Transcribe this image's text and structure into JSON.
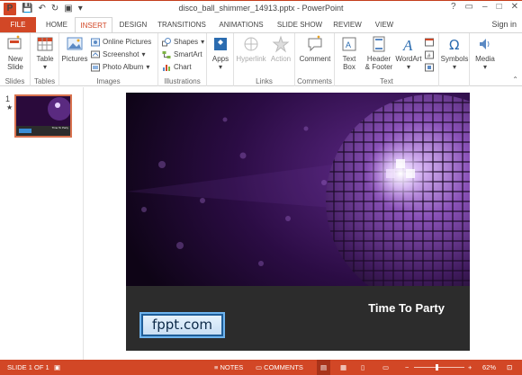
{
  "window": {
    "title": "disco_ball_shimmer_14913.pptx - PowerPoint",
    "app_icon": "P",
    "controls": [
      "?",
      "▭",
      "–",
      "□",
      "✕"
    ]
  },
  "tabs": {
    "items": [
      "FILE",
      "HOME",
      "INSERT",
      "DESIGN",
      "TRANSITIONS",
      "ANIMATIONS",
      "SLIDE SHOW",
      "REVIEW",
      "VIEW"
    ],
    "active": "INSERT",
    "sign_in": "Sign in"
  },
  "ribbon": {
    "slides": {
      "new_slide": "New",
      "new_slide2": "Slide",
      "label": "Slides"
    },
    "tables": {
      "table": "Table",
      "label": "Tables"
    },
    "images": {
      "pictures": "Pictures",
      "online": "Online Pictures",
      "screenshot": "Screenshot",
      "album": "Photo Album",
      "label": "Images"
    },
    "illustrations": {
      "shapes": "Shapes",
      "smartart": "SmartArt",
      "chart": "Chart",
      "label": "Illustrations"
    },
    "apps": {
      "apps": "Apps"
    },
    "links": {
      "hyperlink": "Hyperlink",
      "action": "Action",
      "label": "Links"
    },
    "comments": {
      "comment": "Comment",
      "label": "Comments"
    },
    "text": {
      "textbox1": "Text",
      "textbox2": "Box",
      "header1": "Header",
      "header2": "& Footer",
      "wordart": "WordArt",
      "label": "Text"
    },
    "symbols": {
      "symbols": "Symbols"
    },
    "media": {
      "media": "Media"
    }
  },
  "thumbnails": {
    "number": "1",
    "star": "★",
    "mini_text": "Time To Party"
  },
  "slide": {
    "headline": "Time To Party",
    "logo_text": "fppt.com"
  },
  "status": {
    "slide_info": "SLIDE 1 OF 1",
    "notes": "NOTES",
    "comments": "COMMENTS",
    "zoom": "62%"
  },
  "colors": {
    "accent": "#d24726",
    "slide_bg": "#15061f",
    "band": "#2c2c2c"
  }
}
